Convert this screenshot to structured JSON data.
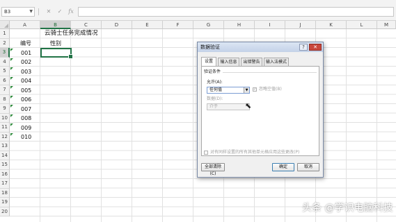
{
  "formula_bar": {
    "name_box": "B3",
    "cancel_symbol": "✕",
    "enter_symbol": "✓",
    "function_symbol": "fx",
    "value": ""
  },
  "columns": [
    "A",
    "B",
    "C",
    "D",
    "E",
    "F",
    "G",
    "H",
    "I",
    "J",
    "K",
    "L",
    "M"
  ],
  "rows": [
    "1",
    "2",
    "3",
    "4",
    "5",
    "6",
    "7",
    "8",
    "9",
    "10",
    "11",
    "12",
    "13",
    "14",
    "15",
    "16",
    "17",
    "18",
    "19",
    "20"
  ],
  "sheet": {
    "title": "云骑士任务完成情况",
    "header_a": "编号",
    "header_b": "性别",
    "ids": [
      "001",
      "002",
      "003",
      "004",
      "005",
      "006",
      "007",
      "008",
      "009",
      "010"
    ]
  },
  "dialog": {
    "title": "数据验证",
    "help": "?",
    "close": "✕",
    "tabs": [
      "设置",
      "输入信息",
      "出错警告",
      "输入法模式"
    ],
    "section": "验证条件",
    "allow_label": "允许(A):",
    "allow_value": "任何值",
    "ignore_blank": "忽略空值(B)",
    "data_label": "数据(D):",
    "data_value": "介于",
    "apply_all": "对有同样设置的所有其他单元格应用这些更改(P)",
    "clear_all": "全部清除(C)",
    "ok": "确定",
    "cancel": "取消"
  },
  "watermark": "头条 @学识电脑科技",
  "colors": {
    "accent": "#217346",
    "dialog_close": "#c9483c"
  }
}
